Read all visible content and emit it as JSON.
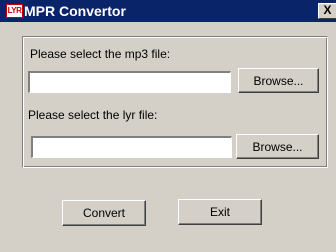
{
  "window": {
    "title": "MPR Convertor",
    "icon_text": "LYR",
    "close_glyph": "X"
  },
  "mp3": {
    "label": "Please select the mp3 file:",
    "value": "",
    "browse_label": "Browse..."
  },
  "lyr": {
    "label": "Please select the lyr file:",
    "value": "",
    "browse_label": "Browse..."
  },
  "actions": {
    "convert_label": "Convert",
    "exit_label": "Exit"
  },
  "colors": {
    "titlebar": "#0a246a",
    "face": "#d4d0c8",
    "field": "#ffffff"
  }
}
